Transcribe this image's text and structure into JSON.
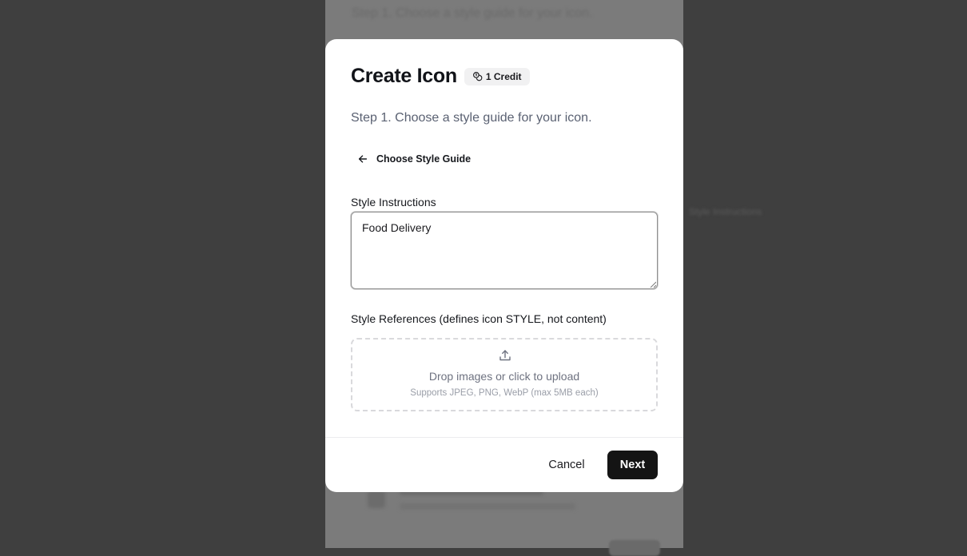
{
  "background": {
    "title": "Step 1. Choose a style guide for your icon.",
    "side_text": "Style Instructions"
  },
  "modal": {
    "title": "Create Icon",
    "credit_badge": "1 Credit",
    "step_text": "Step 1. Choose a style guide for your icon.",
    "back_link": "Choose Style Guide",
    "style_instructions_label": "Style Instructions",
    "style_instructions_value": "Food Delivery",
    "style_references_label": "Style References (defines icon STYLE, not content)",
    "dropzone_main": "Drop images or click to upload",
    "dropzone_sub": "Supports JPEG, PNG, WebP (max 5MB each)",
    "cancel_label": "Cancel",
    "next_label": "Next"
  },
  "colors": {
    "overlay": "#3f3f3f",
    "primary_button": "#141414",
    "muted_text": "#5a6172"
  },
  "icons": {
    "credit": "coins-icon",
    "back": "arrow-left-icon",
    "upload": "upload-icon",
    "resize": "resize-grip-icon"
  }
}
